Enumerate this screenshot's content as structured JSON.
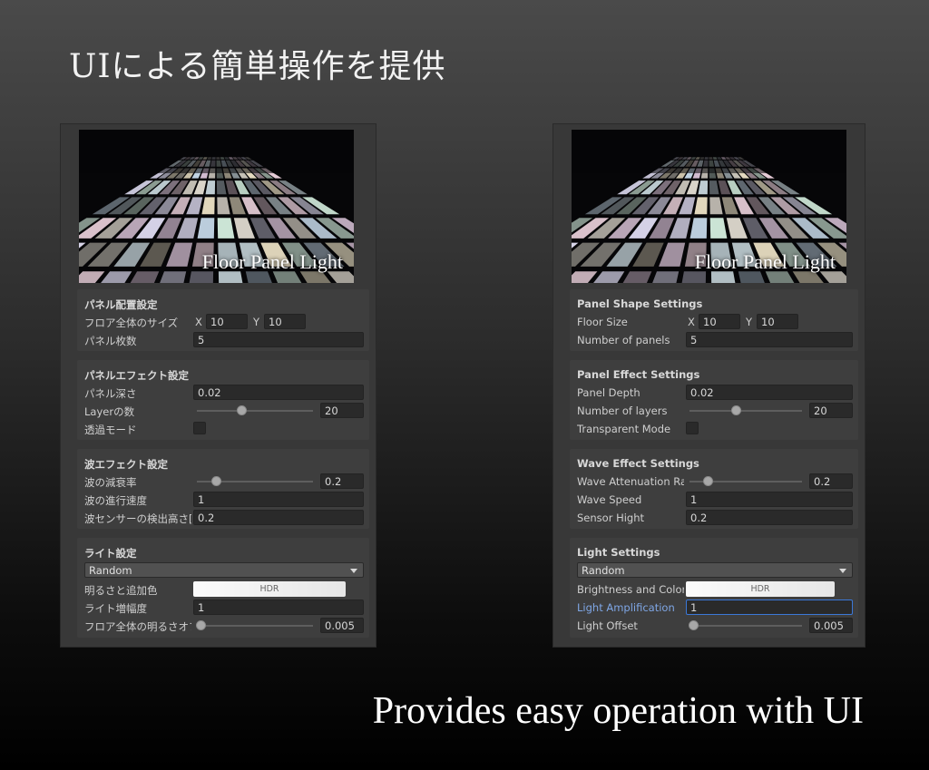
{
  "headline_jp": "UIによる簡単操作を提供",
  "headline_en": "Provides easy operation with UI",
  "banner_title": "Floor Panel Light",
  "colors": {
    "panel_bg": "#383838",
    "section_bg": "#3e3e3e",
    "field_bg": "#2a2a2a",
    "focus": "#3b78d8"
  },
  "left": {
    "shape": {
      "title": "パネル配置設定",
      "floor_size_label": "フロア全体のサイズ",
      "x_label": "X",
      "x_value": "10",
      "y_label": "Y",
      "y_value": "10",
      "panels_label": "パネル枚数",
      "panels_value": "5"
    },
    "effect": {
      "title": "パネルエフェクト設定",
      "depth_label": "パネル深さ",
      "depth_value": "0.02",
      "layers_label": "Layerの数",
      "layers_value": "20",
      "layers_fraction": 0.38,
      "transparent_label": "透過モード"
    },
    "wave": {
      "title": "波エフェクト設定",
      "attenuation_label": "波の減衰率",
      "attenuation_value": "0.2",
      "attenuation_fraction": 0.16,
      "speed_label": "波の進行速度",
      "speed_value": "1",
      "sensor_label": "波センサーの検出高さ[m",
      "sensor_value": "0.2"
    },
    "light": {
      "title": "ライト設定",
      "mode_value": "Random",
      "color_label": "明るさと追加色",
      "hdr_label": "HDR",
      "amp_label": "ライト増幅度",
      "amp_value": "1",
      "offset_label": "フロア全体の明るさオフセット",
      "offset_value": "0.005",
      "offset_fraction": 0.03
    }
  },
  "right": {
    "shape": {
      "title": "Panel Shape Settings",
      "floor_size_label": "Floor Size",
      "x_label": "X",
      "x_value": "10",
      "y_label": "Y",
      "y_value": "10",
      "panels_label": "Number of panels",
      "panels_value": "5"
    },
    "effect": {
      "title": "Panel Effect Settings",
      "depth_label": "Panel Depth",
      "depth_value": "0.02",
      "layers_label": "Number of layers",
      "layers_value": "20",
      "layers_fraction": 0.41,
      "transparent_label": "Transparent Mode"
    },
    "wave": {
      "title": "Wave Effect Settings",
      "attenuation_label": "Wave Attenuation Ra",
      "attenuation_value": "0.2",
      "attenuation_fraction": 0.16,
      "speed_label": "Wave Speed",
      "speed_value": "1",
      "sensor_label": "Sensor Hight",
      "sensor_value": "0.2"
    },
    "light": {
      "title": "Light Settings",
      "mode_value": "Random",
      "color_label": "Brightness and Color",
      "hdr_label": "HDR",
      "amp_label": "Light Amplification",
      "amp_value": "1",
      "offset_label": "Light Offset",
      "offset_value": "0.005",
      "offset_fraction": 0.03
    }
  }
}
